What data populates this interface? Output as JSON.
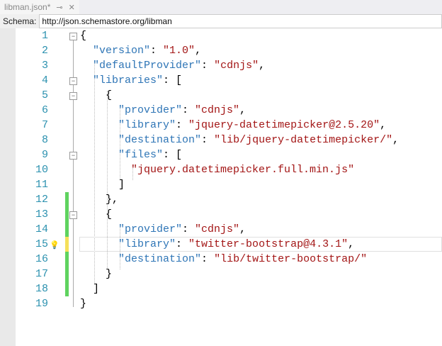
{
  "tab": {
    "title": "libman.json*",
    "pin_icon": "pin-icon",
    "close_icon": "close-icon"
  },
  "schema": {
    "label": "Schema:",
    "value": "http://json.schemastore.org/libman"
  },
  "colors": {
    "key": "#2e75b6",
    "string": "#a31515",
    "line_number": "#2b91af",
    "change_saved": "#5fd35f",
    "change_unsaved": "#f5e05a"
  },
  "lines": [
    {
      "n": "1",
      "tokens": [
        [
          "p",
          "{"
        ]
      ],
      "fold": true
    },
    {
      "n": "2",
      "tokens": [
        [
          "p",
          "  "
        ],
        [
          "k",
          "\"version\""
        ],
        [
          "p",
          ": "
        ],
        [
          "s",
          "\"1.0\""
        ],
        [
          "p",
          ","
        ]
      ]
    },
    {
      "n": "3",
      "tokens": [
        [
          "p",
          "  "
        ],
        [
          "k",
          "\"defaultProvider\""
        ],
        [
          "p",
          ": "
        ],
        [
          "s",
          "\"cdnjs\""
        ],
        [
          "p",
          ","
        ]
      ]
    },
    {
      "n": "4",
      "tokens": [
        [
          "p",
          "  "
        ],
        [
          "k",
          "\"libraries\""
        ],
        [
          "p",
          ": ["
        ]
      ],
      "fold": true
    },
    {
      "n": "5",
      "tokens": [
        [
          "p",
          "    {"
        ]
      ],
      "fold": true
    },
    {
      "n": "6",
      "tokens": [
        [
          "p",
          "      "
        ],
        [
          "k",
          "\"provider\""
        ],
        [
          "p",
          ": "
        ],
        [
          "s",
          "\"cdnjs\""
        ],
        [
          "p",
          ","
        ]
      ]
    },
    {
      "n": "7",
      "tokens": [
        [
          "p",
          "      "
        ],
        [
          "k",
          "\"library\""
        ],
        [
          "p",
          ": "
        ],
        [
          "s",
          "\"jquery-datetimepicker@2.5.20\""
        ],
        [
          "p",
          ","
        ]
      ]
    },
    {
      "n": "8",
      "tokens": [
        [
          "p",
          "      "
        ],
        [
          "k",
          "\"destination\""
        ],
        [
          "p",
          ": "
        ],
        [
          "s",
          "\"lib/jquery-datetimepicker/\""
        ],
        [
          "p",
          ","
        ]
      ]
    },
    {
      "n": "9",
      "tokens": [
        [
          "p",
          "      "
        ],
        [
          "k",
          "\"files\""
        ],
        [
          "p",
          ": ["
        ]
      ],
      "fold": true
    },
    {
      "n": "10",
      "tokens": [
        [
          "p",
          "        "
        ],
        [
          "s",
          "\"jquery.datetimepicker.full.min.js\""
        ]
      ]
    },
    {
      "n": "11",
      "tokens": [
        [
          "p",
          "      ]"
        ]
      ]
    },
    {
      "n": "12",
      "tokens": [
        [
          "p",
          "    },"
        ]
      ],
      "change": "saved"
    },
    {
      "n": "13",
      "tokens": [
        [
          "p",
          "    {"
        ]
      ],
      "fold": true,
      "change": "saved"
    },
    {
      "n": "14",
      "tokens": [
        [
          "p",
          "      "
        ],
        [
          "k",
          "\"provider\""
        ],
        [
          "p",
          ": "
        ],
        [
          "s",
          "\"cdnjs\""
        ],
        [
          "p",
          ","
        ]
      ],
      "change": "saved"
    },
    {
      "n": "15",
      "tokens": [
        [
          "p",
          "      "
        ],
        [
          "k",
          "\"library\""
        ],
        [
          "p",
          ": "
        ],
        [
          "s",
          "\"twitter-bootstrap@4.3.1\""
        ],
        [
          "p",
          ","
        ]
      ],
      "change": "unsaved",
      "current": true,
      "bulb": true
    },
    {
      "n": "16",
      "tokens": [
        [
          "p",
          "      "
        ],
        [
          "k",
          "\"destination\""
        ],
        [
          "p",
          ": "
        ],
        [
          "s",
          "\"lib/twitter-bootstrap/\""
        ]
      ],
      "change": "saved"
    },
    {
      "n": "17",
      "tokens": [
        [
          "p",
          "    }"
        ]
      ],
      "change": "saved"
    },
    {
      "n": "18",
      "tokens": [
        [
          "p",
          "  ]"
        ]
      ],
      "change": "saved"
    },
    {
      "n": "19",
      "tokens": [
        [
          "p",
          "}"
        ]
      ]
    }
  ]
}
